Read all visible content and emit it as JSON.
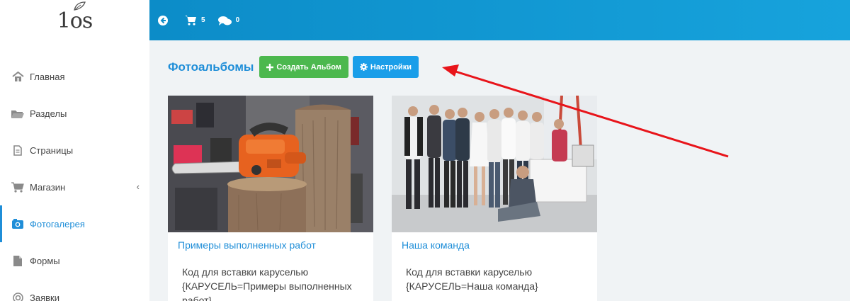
{
  "logo": {
    "text": "1os"
  },
  "sidebar": {
    "items": [
      {
        "label": "Главная",
        "icon": "home-icon"
      },
      {
        "label": "Разделы",
        "icon": "folder-icon"
      },
      {
        "label": "Страницы",
        "icon": "file-icon"
      },
      {
        "label": "Магазин",
        "icon": "cart-icon",
        "chevron": "‹"
      },
      {
        "label": "Фотогалерея",
        "icon": "camera-icon",
        "active": true
      },
      {
        "label": "Формы",
        "icon": "file-icon"
      },
      {
        "label": "Заявки",
        "icon": "target-icon"
      }
    ]
  },
  "topbar": {
    "cart_count": "5",
    "messages_count": "0"
  },
  "main": {
    "title": "Фотоальбомы",
    "create_button": "Создать Альбом",
    "settings_button": "Настройки",
    "albums": [
      {
        "title": "Примеры выполненных работ",
        "code_label": "Код для вставки каруселью",
        "code": "{КАРУСЕЛЬ=Примеры выполненных работ}"
      },
      {
        "title": "Наша команда",
        "code_label": "Код для вставки каруселью",
        "code": "{КАРУСЕЛЬ=Наша команда}"
      }
    ]
  },
  "colors": {
    "accent": "#1f8ed8",
    "topbar": "#0c8cc8",
    "green_button": "#4cb84e",
    "blue_button": "#1a9ee9",
    "annotation_arrow": "#e8141a"
  }
}
